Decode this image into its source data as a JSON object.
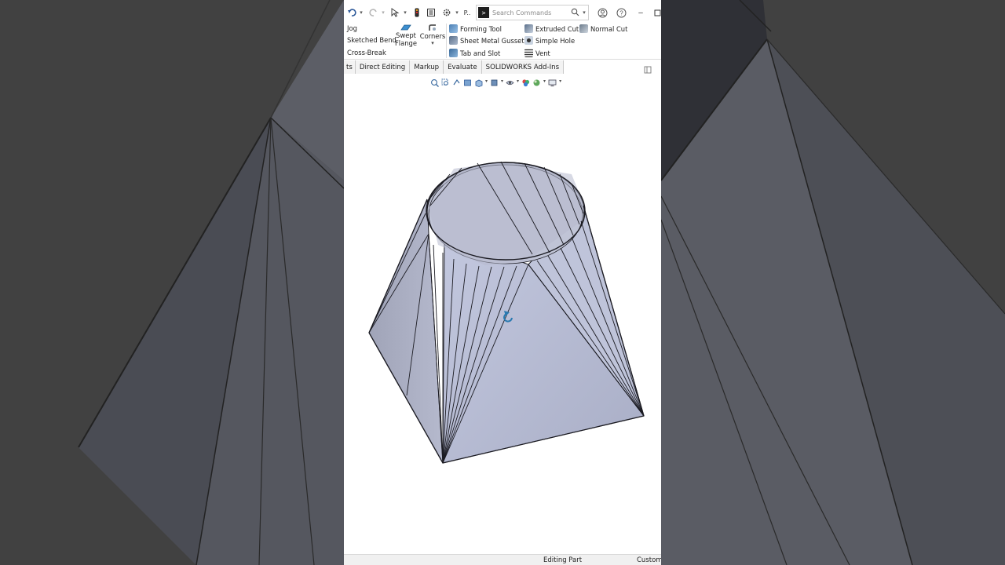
{
  "title_bar": {
    "undo_icon": "undo-icon",
    "redo_icon": "redo-icon",
    "select_icon": "select-pointer-icon",
    "traffic_icon": "rebuild-icon",
    "file_props_icon": "file-properties-icon",
    "options_icon": "gear-icon",
    "overflow_label": "P..",
    "search_placeholder": "Search Commands",
    "help_icon": "help-icon",
    "user_icon": "user-icon",
    "minimize_label": "–"
  },
  "ribbon": {
    "jog": "Jog",
    "sketched_bend": "Sketched Bend",
    "cross_break": "Cross-Break",
    "swept_flange_line1": "Swept",
    "swept_flange_line2": "Flange",
    "corners": "Corners",
    "forming_tool": "Forming Tool",
    "sheet_metal_gusset": "Sheet Metal Gusset",
    "tab_and_slot": "Tab and Slot",
    "extruded_cut": "Extruded Cut",
    "simple_hole": "Simple Hole",
    "vent": "Vent",
    "normal_cut": "Normal Cut"
  },
  "tabs": [
    {
      "label": "ts"
    },
    {
      "label": "Direct Editing"
    },
    {
      "label": "Markup"
    },
    {
      "label": "Evaluate"
    },
    {
      "label": "SOLIDWORKS Add-Ins"
    }
  ],
  "status": {
    "editing": "Editing Part",
    "custom": "Custom"
  },
  "colors": {
    "model_face": "#b9bfd6",
    "model_dark": "#7f8499",
    "model_edge": "#1b1b22",
    "background_blur": "#3b3b3b"
  }
}
